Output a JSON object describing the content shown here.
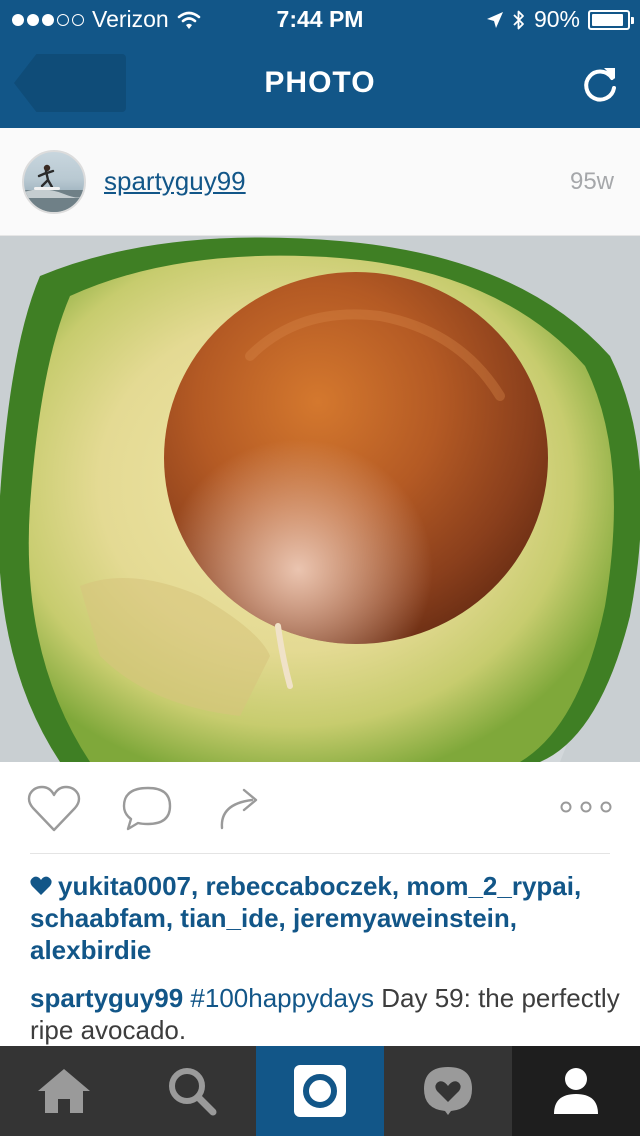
{
  "status_bar": {
    "carrier": "Verizon",
    "time": "7:44 PM",
    "battery": "90%",
    "battery_level": 0.9,
    "signal_bars_filled": 3,
    "signal_bars_total": 5
  },
  "nav": {
    "title": "PHOTO",
    "back_icon": "back-arrow-icon",
    "refresh_icon": "refresh-icon"
  },
  "post": {
    "username": "spartyguy99",
    "age": "95w"
  },
  "likes": {
    "users": [
      "yukita0007",
      "rebeccaboczek",
      "mom_2_rypai",
      "schaabfam",
      "tian_ide",
      "jeremyaweinstein",
      "alexbirdie"
    ],
    "separator": ", "
  },
  "caption": {
    "username": "spartyguy99",
    "hashtag": "#100happydays",
    "text": " Day 59: the perfectly ripe avocado."
  },
  "tabbar": {
    "items": [
      {
        "icon": "home-icon",
        "active": false
      },
      {
        "icon": "search-icon",
        "active": false
      },
      {
        "icon": "camera-icon",
        "active": true
      },
      {
        "icon": "activity-heart-icon",
        "active": false
      },
      {
        "icon": "profile-icon",
        "active": false
      }
    ]
  },
  "colors": {
    "brand_blue": "#125688",
    "tabbar_bg": "#343434",
    "timestamp_gray": "#a5a7aa"
  }
}
